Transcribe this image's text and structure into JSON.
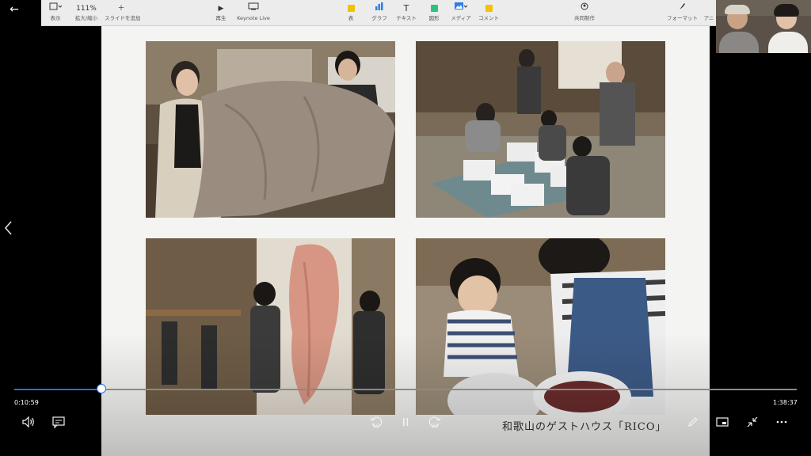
{
  "toolbar": {
    "view_label": "表示",
    "zoom_value": "111%",
    "zoom_label": "拡大/縮小",
    "add_slide_label": "スライドを追加",
    "play_label": "再生",
    "keynote_live_label": "Keynote Live",
    "table_label": "表",
    "chart_label": "グラフ",
    "text_label": "テキスト",
    "shape_label": "図形",
    "media_label": "メディア",
    "comment_label": "コメント",
    "collaborate_label": "共同制作",
    "format_label": "フォーマット",
    "animate_label": "アニ",
    "colors": {
      "table": "#f2c200",
      "chart": "#2b7de9",
      "shape": "#2ec27e",
      "media": "#2b7de9",
      "comment": "#f2c200"
    }
  },
  "slide": {
    "caption": "和歌山のゲストハウス「RICO」",
    "photos": [
      "photo-1",
      "photo-2",
      "photo-3",
      "photo-4"
    ]
  },
  "player": {
    "elapsed": "0:10:59",
    "duration": "1:38:37",
    "progress_fraction": 0.1113,
    "skip_back_seconds": "10",
    "skip_forward_seconds": "30",
    "accent_color": "#1f6fe0"
  }
}
